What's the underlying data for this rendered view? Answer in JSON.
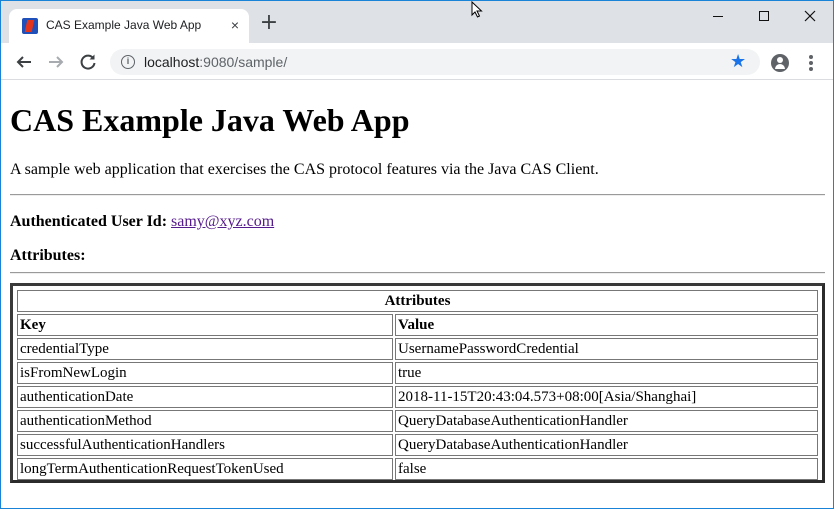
{
  "browser": {
    "tab_title": "CAS Example Java Web App",
    "tab_close": "×",
    "new_tab": "+",
    "url_host": "localhost",
    "url_rest": ":9080/sample/"
  },
  "page": {
    "heading": "CAS Example Java Web App",
    "description": "A sample web application that exercises the CAS protocol features via the Java CAS Client.",
    "user_label": "Authenticated User Id:",
    "user_value": "samy@xyz.com",
    "attributes_heading": "Attributes:"
  },
  "table": {
    "caption": "Attributes",
    "headers": [
      "Key",
      "Value"
    ],
    "rows": [
      [
        "credentialType",
        "UsernamePasswordCredential"
      ],
      [
        "isFromNewLogin",
        "true"
      ],
      [
        "authenticationDate",
        "2018-11-15T20:43:04.573+08:00[Asia/Shanghai]"
      ],
      [
        "authenticationMethod",
        "QueryDatabaseAuthenticationHandler"
      ],
      [
        "successfulAuthenticationHandlers",
        "QueryDatabaseAuthenticationHandler"
      ],
      [
        "longTermAuthenticationRequestTokenUsed",
        "false"
      ]
    ]
  }
}
